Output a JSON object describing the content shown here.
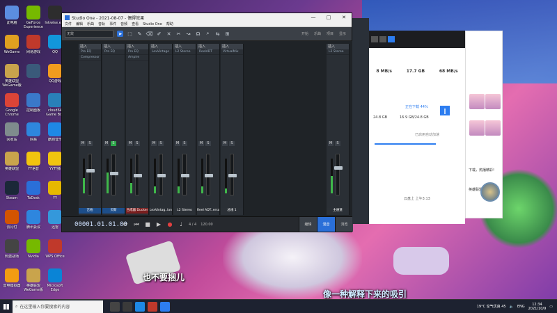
{
  "desktop": {
    "icons": [
      {
        "label": "此电脑",
        "color": "#5b8de0"
      },
      {
        "label": "GeForce Experience",
        "color": "#76b900"
      },
      {
        "label": "Inkwise.exe",
        "color": "#2d2d2d"
      },
      {
        "label": "WeGame",
        "color": "#e0a020"
      },
      {
        "label": "网易游戏",
        "color": "#c0392b"
      },
      {
        "label": "QQ",
        "color": "#1296db"
      },
      {
        "label": "英雄联盟WeGame版",
        "color": "#c9a44c"
      },
      {
        "label": "",
        "color": "#3a5a7a"
      },
      {
        "label": "QQ游戏",
        "color": "#f29c1f"
      },
      {
        "label": "Google Chrome",
        "color": "#db4437"
      },
      {
        "label": "控制面板",
        "color": "#3a78c9"
      },
      {
        "label": "cloud64 Game Box",
        "color": "#2980b9"
      },
      {
        "label": "回收站",
        "color": "#7f8c8d"
      },
      {
        "label": "网易",
        "color": "#2e86de"
      },
      {
        "label": "酷狗音乐",
        "color": "#1e88e5"
      },
      {
        "label": "英雄联盟",
        "color": "#c9a44c"
      },
      {
        "label": "YY语音",
        "color": "#f1c40f"
      },
      {
        "label": "YY开播",
        "color": "#f1c40f"
      },
      {
        "label": "Steam",
        "color": "#1b2838"
      },
      {
        "label": "ToDesk",
        "color": "#2a6fd8"
      },
      {
        "label": "YY",
        "color": "#e6b800"
      },
      {
        "label": "云闪付",
        "color": "#d35400"
      },
      {
        "label": "腾讯会议",
        "color": "#2e86de"
      },
      {
        "label": "迅雷",
        "color": "#3498db"
      },
      {
        "label": "刺激战场",
        "color": "#444"
      },
      {
        "label": "Nvidia",
        "color": "#76b900"
      },
      {
        "label": "WPS Office",
        "color": "#c0392b"
      },
      {
        "label": "雷电模拟器",
        "color": "#f39c12"
      },
      {
        "label": "英雄联盟WeGame版",
        "color": "#c9a44c"
      },
      {
        "label": "Microsoft Edge",
        "color": "#0a84d6"
      }
    ]
  },
  "subtitles": {
    "line1": "也不要捆儿",
    "line2": "像一种解释下来的吸引"
  },
  "studio_one": {
    "title": "Studio One - 2021-08-07 - 偶得效果",
    "menu": [
      "文件",
      "编辑",
      "乐曲",
      "音轨",
      "事件",
      "音频",
      "查看",
      "Studio One",
      "帮助"
    ],
    "toolbar": {
      "preset_select": "无效",
      "tabs": [
        "开始",
        "乐曲",
        "项目",
        "显示"
      ]
    },
    "channels": [
      {
        "name": "吉他",
        "inserts": [
          "Pro EQ",
          "Compressor"
        ],
        "fader": 0.62,
        "meter": 0.45,
        "color": "#1d4e8a",
        "solo": false
      },
      {
        "name": "贝斯",
        "inserts": [
          "Pro EQ"
        ],
        "fader": 0.55,
        "meter": 0.6,
        "color": "#1d4e8a",
        "solo": true
      },
      {
        "name": "合成器 Ducker",
        "inserts": [
          "Pro EQ",
          "Ampire"
        ],
        "fader": 0.5,
        "meter": 0.3,
        "color": "#7a1f1f",
        "solo": false
      },
      {
        "name": "LexVintag..lane",
        "inserts": [
          "LexVintage"
        ],
        "fader": 0.5,
        "meter": 0.2,
        "color": "#2b3036",
        "solo": false
      },
      {
        "name": "L2 Stereo",
        "inserts": [
          "L2 Stereo"
        ],
        "fader": 0.5,
        "meter": 0.2,
        "color": "#2b3036",
        "solo": false
      },
      {
        "name": "Reel ADT..erso",
        "inserts": [
          "ReelADT"
        ],
        "fader": 0.5,
        "meter": 0.2,
        "color": "#2b3036",
        "solo": false
      },
      {
        "name": "总线 1",
        "inserts": [
          "VirtualMix"
        ],
        "fader": 0.5,
        "meter": 0.15,
        "color": "#2b3036",
        "solo": false
      },
      {
        "name": "主通道",
        "inserts": [
          "L2 Stereo"
        ],
        "fader": 0.7,
        "meter": 0.5,
        "color": "#2b3036",
        "solo": false
      }
    ],
    "transport": {
      "time": "00001.01.01.00",
      "signature": "4 / 4",
      "tempo": "120.00",
      "tabs": [
        "编辑",
        "混音",
        "浏览"
      ],
      "active_tab": "混音"
    }
  },
  "download": {
    "sizes": [
      "8 MB/s",
      "17.7 GB",
      "68 MB/s"
    ],
    "status": "正在下载 44%",
    "progress": 0.44,
    "left_size": "24.8 GB",
    "right_size": "16.9 GB/24.8 GB",
    "note": "已启用自动加速",
    "eta": "云盘上 上午3:13"
  },
  "qq": {
    "bubble_text": "下载，热播精彩!",
    "label": "英雄联盟"
  },
  "taskbar": {
    "search_placeholder": "在这里输入你要搜索的内容",
    "weather": "19°C 空气优良 45",
    "ime": "ENG",
    "time": "12:34",
    "date": "2021/10/9"
  }
}
